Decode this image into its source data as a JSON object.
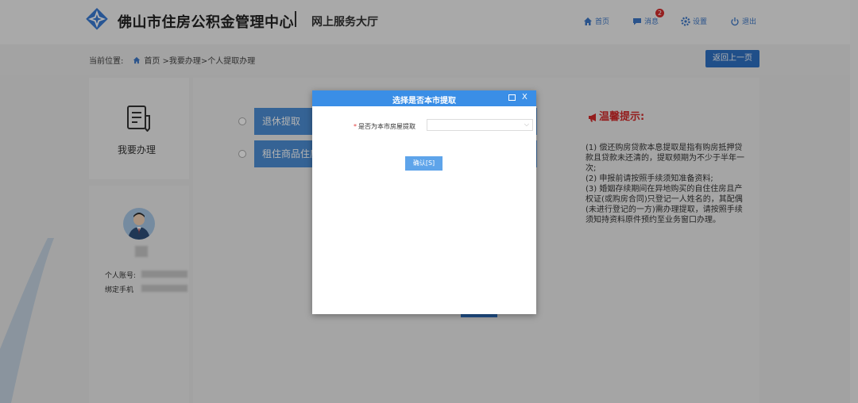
{
  "header": {
    "title": "佛山市住房公积金管理中心",
    "subtitle": "网上服务大厅",
    "nav": {
      "home": "首页",
      "messages": "消息",
      "message_count": "2",
      "settings": "设置",
      "logout": "退出"
    }
  },
  "breadcrumb": {
    "prefix": "当前位置:",
    "path": "首页 >我要办理>个人提取办理"
  },
  "back_button": "返回上一页",
  "sidebar": {
    "todo_label": "我要办理",
    "account_label": "个人账号:",
    "phone_label": "绑定手机"
  },
  "options": [
    {
      "label": "退休提取"
    },
    {
      "label": "租住商品住房"
    }
  ],
  "tips": {
    "title": "温馨提示:",
    "items": [
      "(1) 偿还购房贷款本息提取是指有购房抵押贷款且贷款未还清的，提取频期为不少于半年一次;",
      "(2) 申报前请按照手续须知准备资料;",
      "(3) 婚姻存续期间在异地购买的自住住房且产权证(或购房合同)只登记一人姓名的，其配偶(未进行登记的一方)需办理提取，请按照手续须知持资料原件预约至业务窗口办理。"
    ]
  },
  "modal": {
    "title": "选择是否本市提取",
    "field_label": "是否为本市房屋提取",
    "required_mark": "*",
    "field_value": "",
    "confirm": "确认[S]",
    "close": "X"
  },
  "colors": {
    "primary": "#2f72c4",
    "modal_header": "#3a8ee6",
    "option_bg": "#4d8fd6",
    "tips_title": "#d42a2a"
  }
}
